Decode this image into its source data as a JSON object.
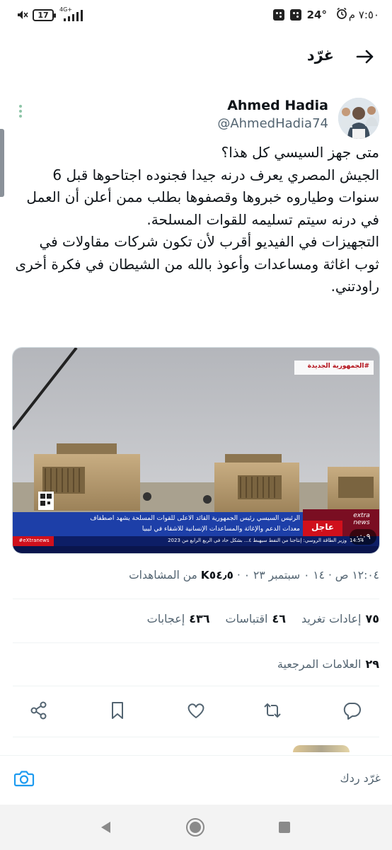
{
  "status_bar": {
    "time": "٧:٥٠ م",
    "temperature": "24°",
    "battery": "17",
    "network": "4G+"
  },
  "header": {
    "title": "غرّد"
  },
  "tweet": {
    "author_name": "Ahmed Hadia",
    "author_handle": "@AhmedHadia74",
    "text": "متى جهز السيسي كل هذا؟\nالجيش المصري يعرف درنه جيدا فجنوده اجتاحوها قبل 6 سنوات وطياروه خبروها وقصفوها بطلب ممن أعلن أن العمل في درنه سيتم تسليمه للقوات المسلحة.\nالتجهيزات في الفيديو أقرب لأن تكون شركات مقاولات في ثوب اغاثة ومساعدات وأعوذ  بالله من الشيطان في فكرة أخرى راودتني.",
    "media": {
      "channel_tag": "#الجمهورية الجديدة",
      "breaking_label": "عاجل",
      "ticker_line1": "الرئيس السيسي رئيس الجمهورية القائد الأعلى للقوات المسلحة يشهد اصطفاف",
      "ticker_line2": "معدات الدعم والإغاثة والمساعدات الإنسانية للأشقاء في ليبيا",
      "news_line": "وزير الطاقة الروسي: إنتاجنا من النفط سيهبط ٤...   بشكل حاد في الربع الرابع من 2023",
      "channel_small": "#eXtranews",
      "time_small": "14:54",
      "duration": "٠:٠٩",
      "channel_logo": "extra news"
    },
    "timestamp": "١٢:٠٤ ص · ١٤ ٠ سبتمبر ٢٣ ٠ ·",
    "views_count": "K٥٤٫٥",
    "views_label": "من المشاهدات",
    "retweets_count": "٧٥",
    "retweets_label": "إعادات تغريد",
    "quotes_count": "٤٦",
    "quotes_label": "اقتباسات",
    "likes_count": "٤٣٦",
    "likes_label": "إعجابات",
    "bookmarks_count": "٢٩",
    "bookmarks_label": "العلامات المرجعية"
  },
  "reply_bar": {
    "placeholder": "غرّد ردك"
  },
  "colors": {
    "accent": "#1d9bf0",
    "text_secondary": "#536471",
    "text_primary": "#0f1419",
    "breaking_red": "#d0101c"
  },
  "icons": {
    "back": "arrow-right-icon",
    "share": "share-icon",
    "bookmark": "bookmark-icon",
    "like": "heart-icon",
    "retweet": "retweet-icon",
    "reply": "reply-icon",
    "camera": "camera-icon",
    "more": "more-vertical-icon"
  }
}
